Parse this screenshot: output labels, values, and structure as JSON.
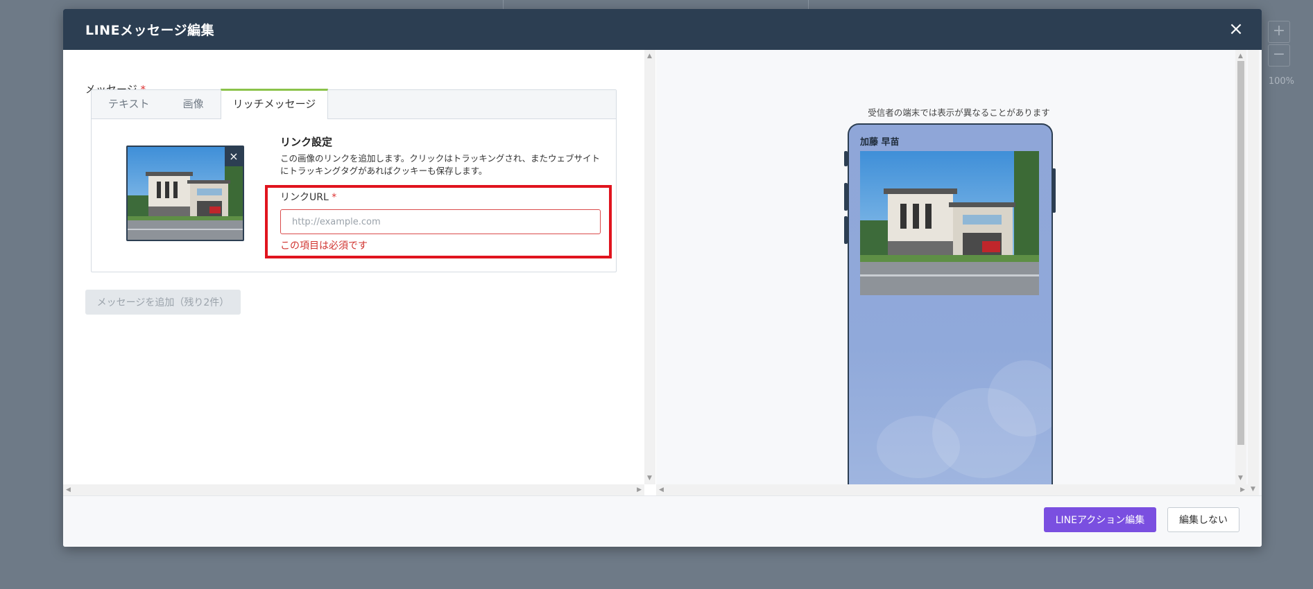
{
  "modal": {
    "title": "LINEメッセージ編集",
    "close_icon": "×"
  },
  "message": {
    "label": "メッセージ",
    "required_mark": "*",
    "tabs": [
      {
        "label": "テキスト",
        "active": false
      },
      {
        "label": "画像",
        "active": false
      },
      {
        "label": "リッチメッセージ",
        "active": true
      }
    ],
    "remove_image_icon": "×",
    "link": {
      "title": "リンク設定",
      "description": "この画像のリンクを追加します。クリックはトラッキングされ、またウェブサイトにトラッキングタグがあればクッキーも保存します。",
      "url_label": "リンクURL",
      "required_mark": "*",
      "url_value": "",
      "url_placeholder": "http://example.com",
      "url_error": "この項目は必須です"
    },
    "add_button": "メッセージを追加（残り2件）"
  },
  "preview": {
    "note": "受信者の端末では表示が異なることがあります",
    "sender_name": "加藤 早苗"
  },
  "footer": {
    "primary_button": "LINEアクション編集",
    "secondary_button": "編集しない"
  },
  "background": {
    "zoom_in_icon": "+",
    "zoom_out_icon": "−",
    "zoom_level": "100%"
  },
  "colors": {
    "header_bg": "#2c3e52",
    "tab_active_accent": "#8bc34a",
    "error_red": "#e0141e",
    "primary_button": "#7a4fe0",
    "phone_bg": "#8fa6d8"
  }
}
